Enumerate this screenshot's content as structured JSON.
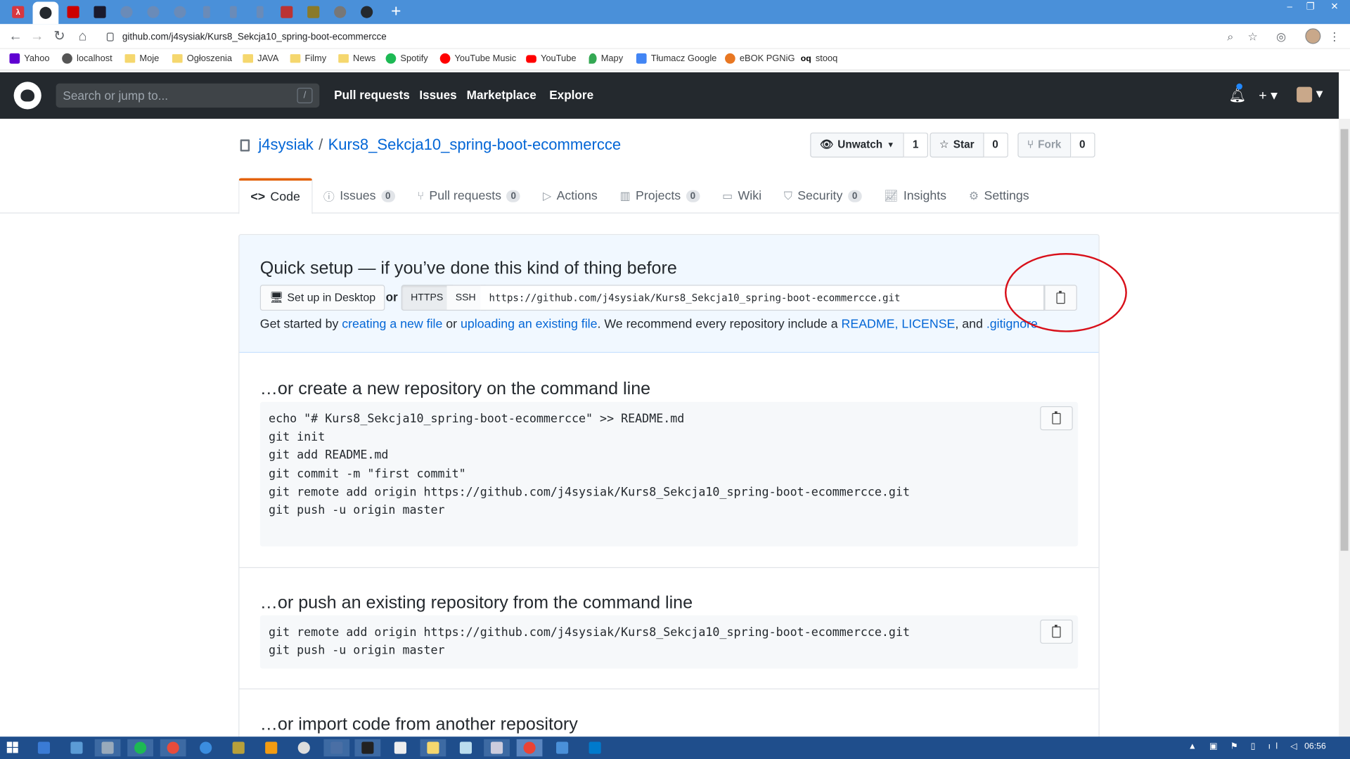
{
  "browser": {
    "url": "github.com/j4sysiak/Kurs8_Sekcja10_spring-boot-ecommercce",
    "bookmarks": [
      {
        "label": "Yahoo",
        "icon": "yahoo-icon"
      },
      {
        "label": "localhost",
        "icon": "globe-icon"
      },
      {
        "label": "Moje",
        "icon": "folder-icon"
      },
      {
        "label": "Ogłoszenia",
        "icon": "folder-icon"
      },
      {
        "label": "JAVA",
        "icon": "folder-icon"
      },
      {
        "label": "Filmy",
        "icon": "folder-icon"
      },
      {
        "label": "News",
        "icon": "folder-icon"
      },
      {
        "label": "Spotify",
        "icon": "spotify-icon"
      },
      {
        "label": "YouTube Music",
        "icon": "youtube-music-icon"
      },
      {
        "label": "YouTube",
        "icon": "youtube-icon"
      },
      {
        "label": "Mapy",
        "icon": "maps-icon"
      },
      {
        "label": "Tłumacz Google",
        "icon": "translate-icon"
      },
      {
        "label": "eBOK PGNiG",
        "icon": "flame-icon"
      },
      {
        "label": "stooq",
        "icon": "stooq-icon"
      }
    ]
  },
  "github": {
    "search_placeholder": "Search or jump to...",
    "search_key": "/",
    "nav": [
      "Pull requests",
      "Issues",
      "Marketplace",
      "Explore"
    ]
  },
  "repo": {
    "owner": "j4sysiak",
    "separator": "/",
    "name": "Kurs8_Sekcja10_spring-boot-ecommercce",
    "watch_label": "Unwatch",
    "watch_count": "1",
    "star_label": "Star",
    "star_count": "0",
    "fork_label": "Fork",
    "fork_count": "0",
    "tabs": [
      {
        "label": "Code",
        "count": ""
      },
      {
        "label": "Issues",
        "count": "0"
      },
      {
        "label": "Pull requests",
        "count": "0"
      },
      {
        "label": "Actions",
        "count": ""
      },
      {
        "label": "Projects",
        "count": "0"
      },
      {
        "label": "Wiki",
        "count": ""
      },
      {
        "label": "Security",
        "count": "0"
      },
      {
        "label": "Insights",
        "count": ""
      },
      {
        "label": "Settings",
        "count": ""
      }
    ]
  },
  "quick_setup": {
    "title": "Quick setup — if you’ve done this kind of thing before",
    "desktop_button": "Set up in Desktop",
    "or": "or",
    "https": "HTTPS",
    "ssh": "SSH",
    "clone_url": "https://github.com/j4sysiak/Kurs8_Sekcja10_spring-boot-ecommercce.git",
    "get_started_1": "Get started by ",
    "link_new_file": "creating a new file",
    "get_started_2": " or ",
    "link_upload": "uploading an existing file",
    "get_started_3": ". We recommend every repository include a ",
    "link_readme": "README",
    "comma1": ", ",
    "link_license": "LICENSE",
    "comma2": ", and ",
    "link_gitignore": ".gitignore",
    "period": "."
  },
  "new_repo": {
    "title": "…or create a new repository on the command line",
    "code": "echo \"# Kurs8_Sekcja10_spring-boot-ecommercce\" >> README.md\ngit init\ngit add README.md\ngit commit -m \"first commit\"\ngit remote add origin https://github.com/j4sysiak/Kurs8_Sekcja10_spring-boot-ecommercce.git\ngit push -u origin master"
  },
  "push_repo": {
    "title": "…or push an existing repository from the command line",
    "code": "git remote add origin https://github.com/j4sysiak/Kurs8_Sekcja10_spring-boot-ecommercce.git\ngit push -u origin master"
  },
  "import_repo": {
    "title": "…or import code from another repository"
  },
  "taskbar": {
    "clock": "06:56"
  },
  "colors": {
    "link": "#0366d6",
    "header": "#24292e",
    "tab_accent": "#e36209",
    "annotation": "#d8101a"
  }
}
